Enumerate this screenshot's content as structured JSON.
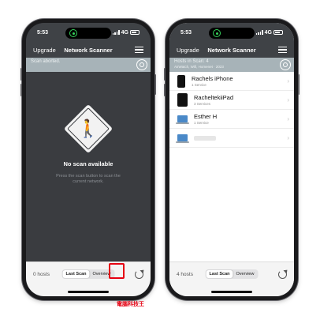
{
  "left_phone": {
    "status": {
      "time": "5:53",
      "network": "4G"
    },
    "nav": {
      "upgrade": "Upgrade",
      "title": "Network Scanner"
    },
    "info_bar": {
      "text": "Scan aborted."
    },
    "empty_state": {
      "title": "No scan available",
      "hint": "Press the scan button to scan the current network."
    },
    "bottom": {
      "host_count": "0 hosts",
      "tab_last_scan": "Last Scan",
      "tab_overview": "Overview"
    }
  },
  "right_phone": {
    "status": {
      "time": "5:53",
      "network": "4G"
    },
    "nav": {
      "upgrade": "Upgrade",
      "title": "Network Scanner"
    },
    "info_bar": {
      "line1": "Hosts in Scan: 4",
      "line2": "AirWatch, Wifi, Homenet · 2023"
    },
    "hosts": [
      {
        "name": "Rachels iPhone",
        "sub": "1 Service",
        "icon": "phone-icon"
      },
      {
        "name": "RacheltekiiPad",
        "sub": "3 Services",
        "icon": "tablet-icon"
      },
      {
        "name": "Esther H",
        "sub": "1 Service",
        "icon": "laptop-icon"
      },
      {
        "name": "",
        "sub": "",
        "icon": "laptop-icon"
      }
    ],
    "bottom": {
      "host_count": "4 hosts",
      "tab_last_scan": "Last Scan",
      "tab_overview": "Overview"
    }
  },
  "watermark": "電腦科技王",
  "colors": {
    "highlight": "#e60012",
    "nav_bg": "#3f4246",
    "info_bar": "#a7b3b8"
  }
}
